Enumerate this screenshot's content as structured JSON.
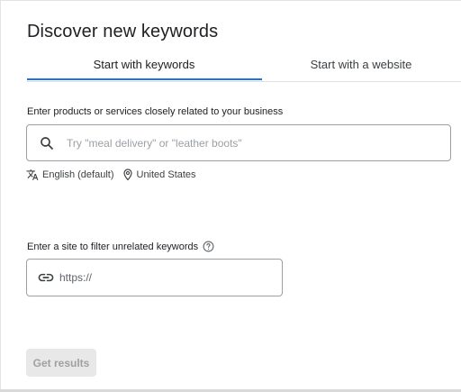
{
  "header": {
    "title": "Discover new keywords"
  },
  "tabs": [
    {
      "label": "Start with keywords",
      "active": true
    },
    {
      "label": "Start with a website",
      "active": false
    }
  ],
  "products_section": {
    "label": "Enter products or services closely related to your business",
    "search_placeholder": "Try \"meal delivery\" or \"leather boots\"",
    "search_value": "",
    "language": "English (default)",
    "location": "United States"
  },
  "site_filter": {
    "label": "Enter a site to filter unrelated keywords",
    "placeholder": "https://",
    "value": ""
  },
  "actions": {
    "get_results_label": "Get results",
    "get_results_enabled": false
  },
  "icons": {
    "search": "search-icon",
    "translate": "translate-icon",
    "location": "location-pin-icon",
    "help": "help-circle-icon",
    "link": "link-icon"
  },
  "colors": {
    "accent": "#1a73e8",
    "text": "#202124",
    "border": "#9aa0a6",
    "disabled_button_bg": "#e8e8e8",
    "disabled_button_text": "#a0a0a0"
  }
}
